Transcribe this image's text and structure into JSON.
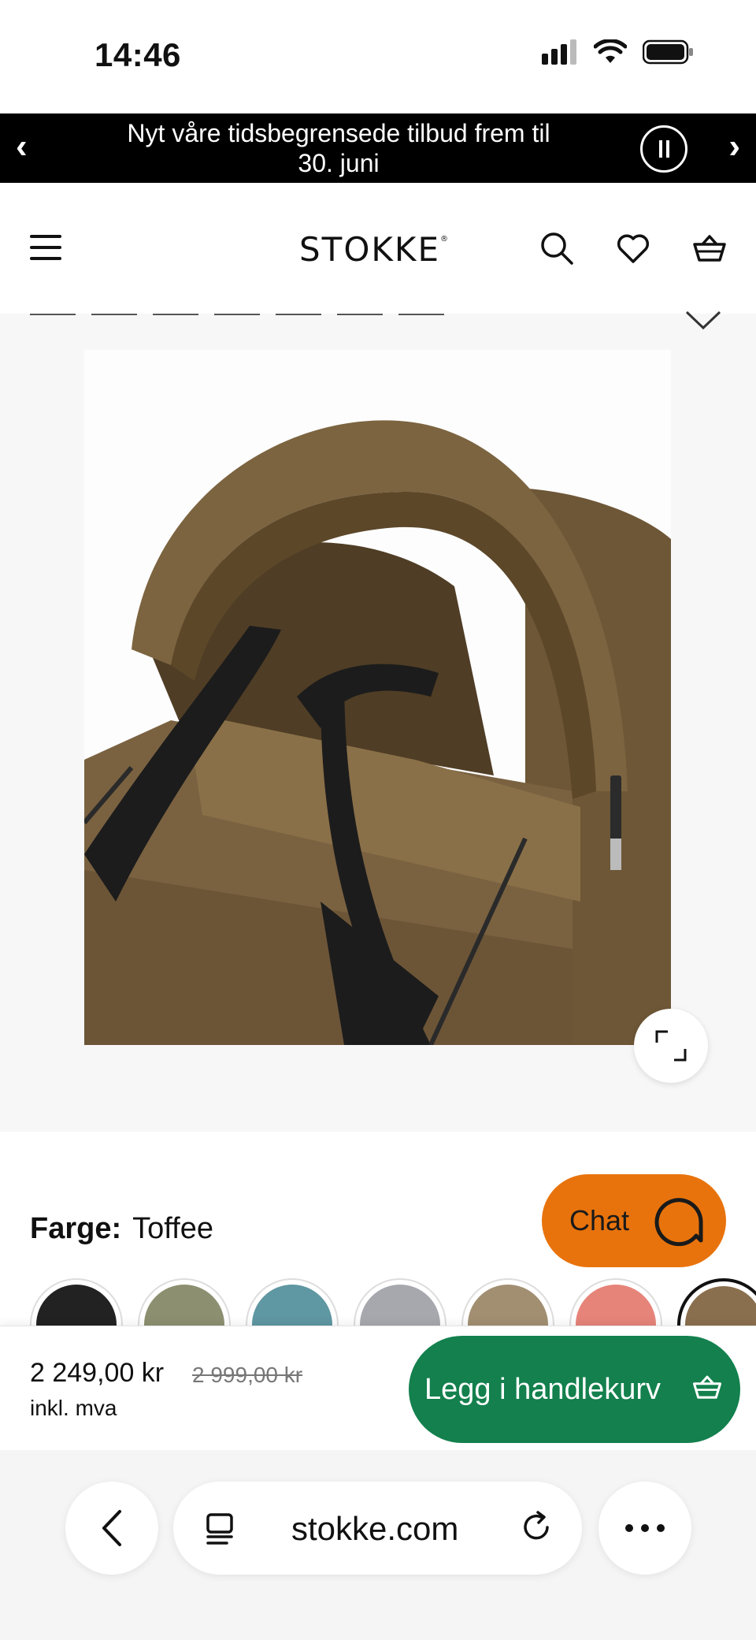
{
  "status_bar": {
    "time": "14:46"
  },
  "promo": {
    "line1": "Nyt våre tidsbegrensede tilbud frem til",
    "line2": "30. juni",
    "prev": "‹",
    "next": "›"
  },
  "header": {
    "logo": "STOKKE",
    "logo_mark": "®"
  },
  "product": {
    "color_label": "Farge:",
    "color_value": "Toffee",
    "swatches": [
      {
        "name": "Black",
        "color": "#222222"
      },
      {
        "name": "Olive",
        "color": "#8c9070"
      },
      {
        "name": "Aqua",
        "color": "#5f97a2"
      },
      {
        "name": "Stone",
        "color": "#a6a8ae"
      },
      {
        "name": "Taupe",
        "color": "#a28f72"
      },
      {
        "name": "Ginger",
        "color": "#e6847a"
      },
      {
        "name": "Toffee",
        "color": "#8a6f4e",
        "selected": true
      }
    ],
    "image_colors": {
      "fabric": "#7d6540",
      "fabric_dark": "#5e4a2d",
      "strap": "#1c1c1c"
    }
  },
  "chat": {
    "label": "Chat"
  },
  "price": {
    "current": "2 249,00 kr",
    "original": "2 999,00 kr",
    "note": "inkl. mva"
  },
  "cart": {
    "label": "Legg i handlekurv"
  },
  "browser": {
    "url": "stokke.com"
  },
  "colors": {
    "cart_green": "#13804d",
    "chat_orange": "#e8730c",
    "banner_black": "#000000"
  }
}
